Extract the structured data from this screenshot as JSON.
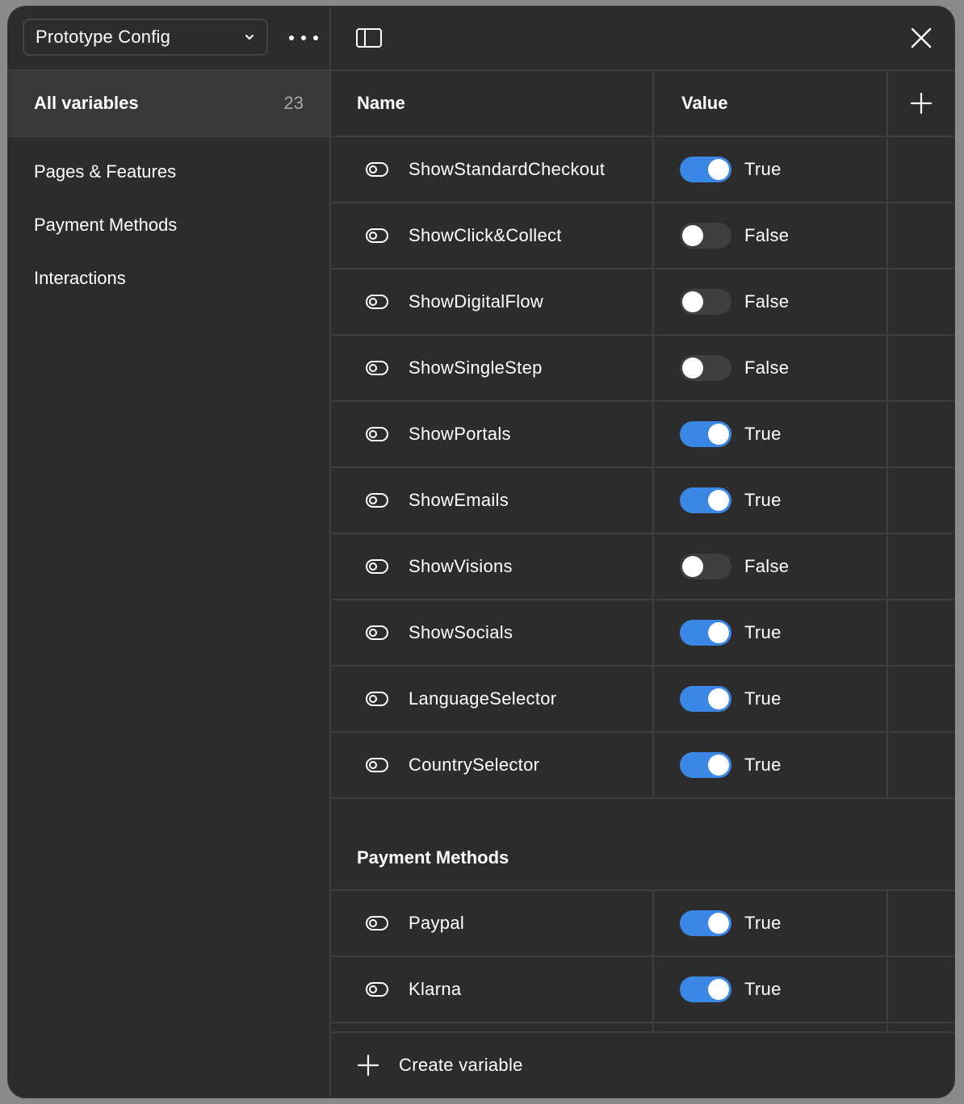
{
  "sidebar": {
    "collection": "Prototype Config",
    "all_variables": {
      "label": "All variables",
      "count": "23"
    },
    "groups": [
      "Pages & Features",
      "Payment Methods",
      "Interactions"
    ]
  },
  "table": {
    "headers": {
      "name": "Name",
      "value": "Value"
    },
    "rows": [
      {
        "name": "ShowStandardCheckout",
        "on": true,
        "value": "True"
      },
      {
        "name": "ShowClick&Collect",
        "on": false,
        "value": "False"
      },
      {
        "name": "ShowDigitalFlow",
        "on": false,
        "value": "False"
      },
      {
        "name": "ShowSingleStep",
        "on": false,
        "value": "False"
      },
      {
        "name": "ShowPortals",
        "on": true,
        "value": "True"
      },
      {
        "name": "ShowEmails",
        "on": true,
        "value": "True"
      },
      {
        "name": "ShowVisions",
        "on": false,
        "value": "False"
      },
      {
        "name": "ShowSocials",
        "on": true,
        "value": "True"
      },
      {
        "name": "LanguageSelector",
        "on": true,
        "value": "True"
      },
      {
        "name": "CountrySelector",
        "on": true,
        "value": "True"
      }
    ],
    "section_title": "Payment Methods",
    "section_rows": [
      {
        "name": "Paypal",
        "on": true,
        "value": "True"
      },
      {
        "name": "Klarna",
        "on": true,
        "value": "True"
      }
    ]
  },
  "footer": {
    "create_label": "Create variable"
  },
  "colors": {
    "accent": "#3a87e6",
    "background": "#2c2c2c",
    "border": "#3e3e3e"
  }
}
